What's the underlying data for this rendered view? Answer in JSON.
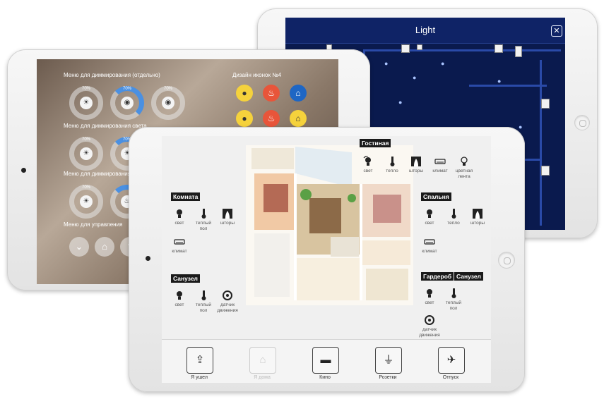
{
  "light_tablet": {
    "title": "Light",
    "close_symbol": "✕"
  },
  "menu_tablet": {
    "labels": [
      "Меню для диммирования (отдельно)",
      "Меню для диммирования света",
      "Меню для диммирования",
      "Меню для управления",
      "Дизайн иконок №4"
    ],
    "dial_values": [
      "70%",
      "70%",
      "70%",
      "70%",
      "70%",
      "70%"
    ]
  },
  "front_tablet": {
    "rooms": {
      "living": {
        "name": "Гостиная",
        "devices": [
          "свет",
          "тепло",
          "шторы",
          "климат",
          "цветная лента"
        ]
      },
      "room": {
        "name": "Комната",
        "devices": [
          "свет",
          "теплый пол",
          "шторы",
          "климат"
        ]
      },
      "bath": {
        "name": "Санузел",
        "devices": [
          "свет",
          "теплый пол",
          "датчик движения"
        ]
      },
      "bedroom": {
        "name": "Спальня",
        "devices": [
          "свет",
          "тепло",
          "шторы",
          "климат"
        ]
      },
      "wardrobe": {
        "name": "Гардероб",
        "devices": [
          "свет",
          "датчик движения"
        ]
      },
      "bath2": {
        "name": "Санузел",
        "devices": [
          "теплый пол"
        ]
      }
    },
    "bottom_bar": [
      {
        "label": "Я ушел",
        "icon": "leave-icon",
        "active": true
      },
      {
        "label": "Я дома",
        "icon": "home-icon",
        "active": false
      },
      {
        "label": "Кино",
        "icon": "clapper-icon",
        "active": true
      },
      {
        "label": "Розетки",
        "icon": "plug-icon",
        "active": true
      },
      {
        "label": "Отпуск",
        "icon": "plane-icon",
        "active": true
      }
    ],
    "page_indicator": {
      "pages": 2,
      "current": 1
    }
  }
}
